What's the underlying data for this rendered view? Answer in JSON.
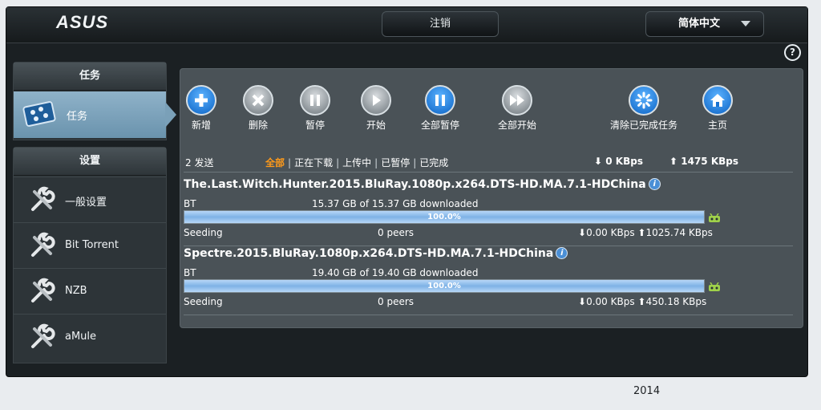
{
  "header": {
    "logo": "ASUS",
    "logout": "注销",
    "language": "简体中文"
  },
  "help": "?",
  "sidebar": {
    "tasks_title": "任务",
    "tasks_item": "任务",
    "settings_title": "设置",
    "settings_items": [
      {
        "label": "一般设置"
      },
      {
        "label": "Bit Torrent"
      },
      {
        "label": "NZB"
      },
      {
        "label": "aMule"
      }
    ]
  },
  "toolbar": [
    {
      "label": "新增",
      "icon": "plus-icon"
    },
    {
      "label": "删除",
      "icon": "x-icon"
    },
    {
      "label": "暂停",
      "icon": "pause-icon"
    },
    {
      "label": "开始",
      "icon": "play-icon"
    },
    {
      "label": "全部暂停",
      "icon": "pause-all-icon"
    },
    {
      "label": "全部开始",
      "icon": "start-all-icon"
    },
    {
      "label": "清除已完成任务",
      "icon": "clear-completed-icon"
    },
    {
      "label": "主页",
      "icon": "home-icon"
    }
  ],
  "filters": {
    "count": "2 发送",
    "items": [
      "全部",
      "正在下载",
      "上传中",
      "已暂停",
      "已完成"
    ],
    "active": "全部",
    "sep": "|",
    "down_speed": "0 KBps",
    "up_speed": "1475 KBps"
  },
  "torrents": [
    {
      "name": "The.Last.Witch.Hunter.2015.BluRay.1080p.x264.DTS-HD.MA.7.1-HDChina",
      "type": "BT",
      "size": "15.37 GB of 15.37 GB downloaded",
      "progress": 100.0,
      "progress_text": "100.0%",
      "status": "Seeding",
      "peers": "0 peers",
      "down": "0.00 KBps",
      "up": "1025.74 KBps"
    },
    {
      "name": "Spectre.2015.BluRay.1080p.x264.DTS-HD.MA.7.1-HDChina",
      "type": "BT",
      "size": "19.40 GB of 19.40 GB downloaded",
      "progress": 100.0,
      "progress_text": "100.0%",
      "status": "Seeding",
      "peers": "0 peers",
      "down": "0.00 KBps",
      "up": "450.18 KBps"
    }
  ],
  "footer": "2014",
  "colors": {
    "accent_filter": "#ff9a1a",
    "button_blue": "#0c63c4",
    "progress": "#7eb2e6"
  }
}
